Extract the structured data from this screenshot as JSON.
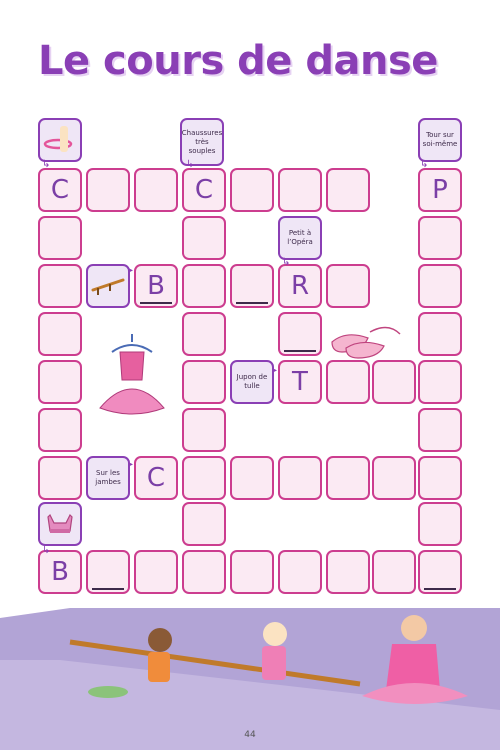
{
  "title": "Le cours de danse",
  "clues": {
    "chaussures": "Chaussures très souples",
    "tour": "Tour sur soi-même",
    "petit": "Petit à l’Opéra",
    "jupon": "Jupon de tulle",
    "jambes": "Sur les jambes"
  },
  "letters": {
    "c1": "C",
    "c2": "C",
    "p": "P",
    "b1": "B",
    "r": "R",
    "t": "T",
    "c3": "C",
    "b2": "B"
  },
  "page_number": "44",
  "colors": {
    "title": "#8a3fb5",
    "cell_border": "#cc3d8f",
    "cell_fill": "#fbeaf3",
    "clue_border": "#8a3fb5",
    "clue_fill": "#efe6f6",
    "floor": "#c4b7e0",
    "wall": "#b2a4d6"
  }
}
